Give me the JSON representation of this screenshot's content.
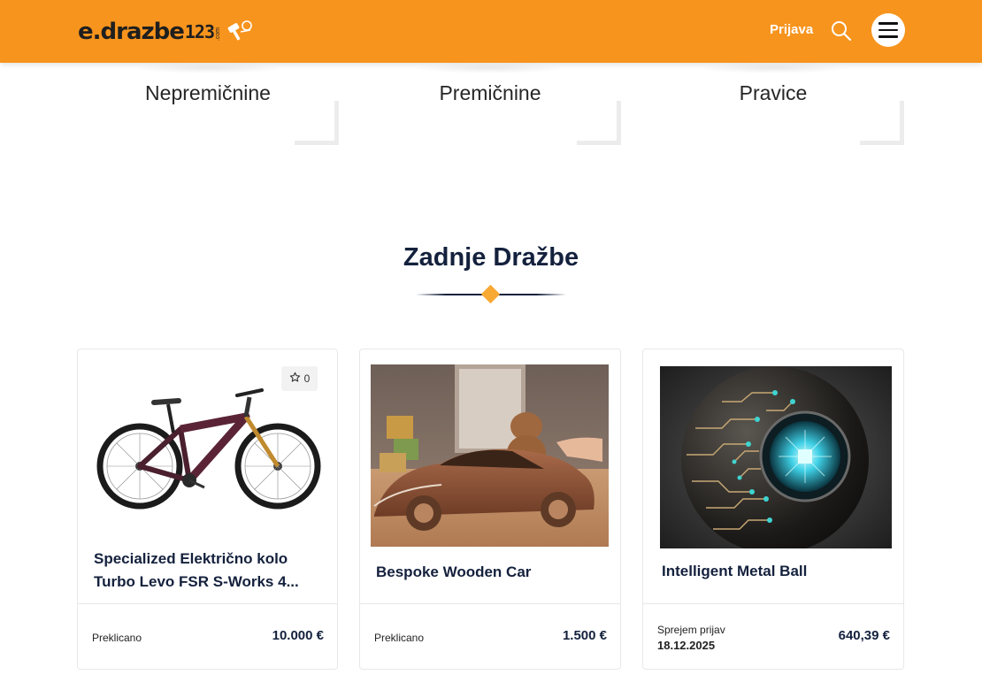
{
  "header": {
    "logo": {
      "main": "e.drazbe",
      "num": "123",
      "com": ".com"
    },
    "login_label": "Prijava",
    "icons": {
      "search": "search-icon",
      "menu": "hamburger-menu-icon",
      "logo": "gavel-icon"
    }
  },
  "categories": [
    {
      "label": "Nepremičnine"
    },
    {
      "label": "Premičnine"
    },
    {
      "label": "Pravice"
    }
  ],
  "section": {
    "title": "Zadnje Dražbe"
  },
  "auctions": [
    {
      "title": "Specialized Električno kolo Turbo Levo FSR S-Works 4...",
      "status": "Preklicano",
      "date": "",
      "price": "10.000 €",
      "favorites": "0",
      "image": "electric-mountain-bike"
    },
    {
      "title": "Bespoke Wooden Car",
      "status": "Preklicano",
      "date": "",
      "price": "1.500 €",
      "image": "wooden-toy-car"
    },
    {
      "title": "Intelligent Metal Ball",
      "status": "Sprejem prijav",
      "date": "18.12.2025",
      "price": "640,39 €",
      "image": "circuit-metal-sphere"
    }
  ],
  "colors": {
    "brand": "#f7941d",
    "title": "#14213d",
    "accent": "#f7a934"
  }
}
